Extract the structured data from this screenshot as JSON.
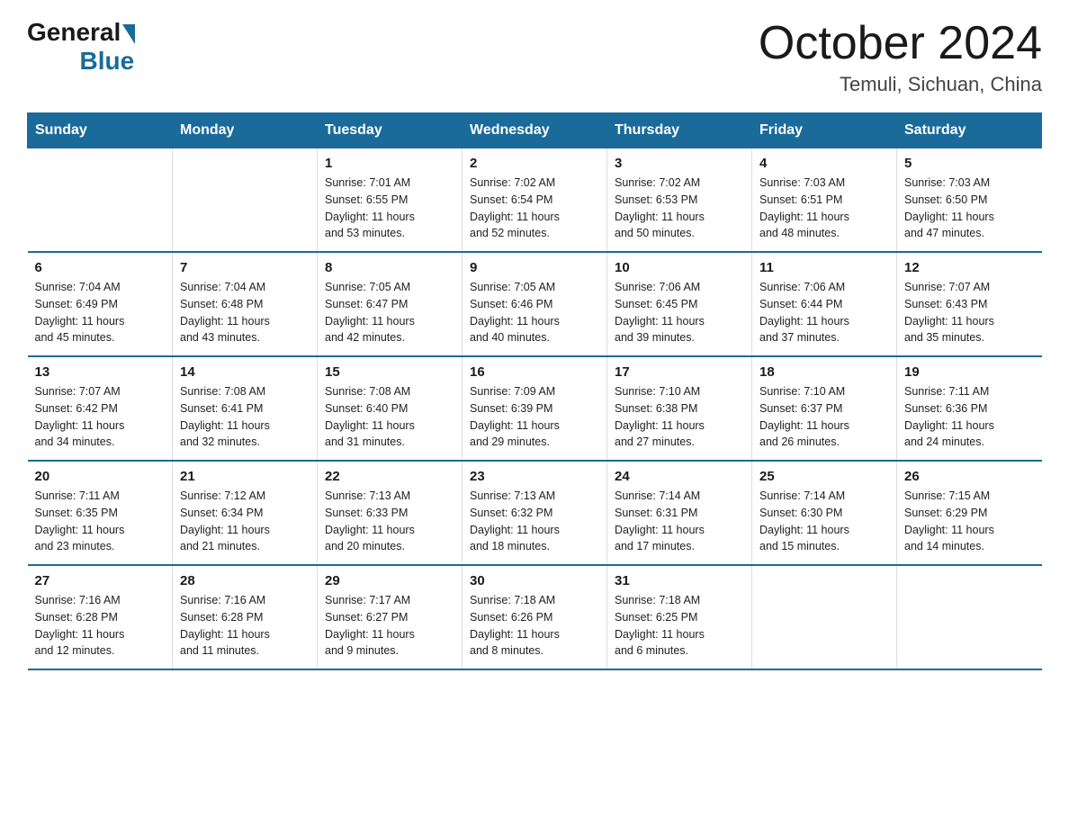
{
  "logo": {
    "general": "General",
    "blue": "Blue"
  },
  "title": "October 2024",
  "location": "Temuli, Sichuan, China",
  "days_of_week": [
    "Sunday",
    "Monday",
    "Tuesday",
    "Wednesday",
    "Thursday",
    "Friday",
    "Saturday"
  ],
  "weeks": [
    [
      {
        "day": "",
        "info": ""
      },
      {
        "day": "",
        "info": ""
      },
      {
        "day": "1",
        "info": "Sunrise: 7:01 AM\nSunset: 6:55 PM\nDaylight: 11 hours\nand 53 minutes."
      },
      {
        "day": "2",
        "info": "Sunrise: 7:02 AM\nSunset: 6:54 PM\nDaylight: 11 hours\nand 52 minutes."
      },
      {
        "day": "3",
        "info": "Sunrise: 7:02 AM\nSunset: 6:53 PM\nDaylight: 11 hours\nand 50 minutes."
      },
      {
        "day": "4",
        "info": "Sunrise: 7:03 AM\nSunset: 6:51 PM\nDaylight: 11 hours\nand 48 minutes."
      },
      {
        "day": "5",
        "info": "Sunrise: 7:03 AM\nSunset: 6:50 PM\nDaylight: 11 hours\nand 47 minutes."
      }
    ],
    [
      {
        "day": "6",
        "info": "Sunrise: 7:04 AM\nSunset: 6:49 PM\nDaylight: 11 hours\nand 45 minutes."
      },
      {
        "day": "7",
        "info": "Sunrise: 7:04 AM\nSunset: 6:48 PM\nDaylight: 11 hours\nand 43 minutes."
      },
      {
        "day": "8",
        "info": "Sunrise: 7:05 AM\nSunset: 6:47 PM\nDaylight: 11 hours\nand 42 minutes."
      },
      {
        "day": "9",
        "info": "Sunrise: 7:05 AM\nSunset: 6:46 PM\nDaylight: 11 hours\nand 40 minutes."
      },
      {
        "day": "10",
        "info": "Sunrise: 7:06 AM\nSunset: 6:45 PM\nDaylight: 11 hours\nand 39 minutes."
      },
      {
        "day": "11",
        "info": "Sunrise: 7:06 AM\nSunset: 6:44 PM\nDaylight: 11 hours\nand 37 minutes."
      },
      {
        "day": "12",
        "info": "Sunrise: 7:07 AM\nSunset: 6:43 PM\nDaylight: 11 hours\nand 35 minutes."
      }
    ],
    [
      {
        "day": "13",
        "info": "Sunrise: 7:07 AM\nSunset: 6:42 PM\nDaylight: 11 hours\nand 34 minutes."
      },
      {
        "day": "14",
        "info": "Sunrise: 7:08 AM\nSunset: 6:41 PM\nDaylight: 11 hours\nand 32 minutes."
      },
      {
        "day": "15",
        "info": "Sunrise: 7:08 AM\nSunset: 6:40 PM\nDaylight: 11 hours\nand 31 minutes."
      },
      {
        "day": "16",
        "info": "Sunrise: 7:09 AM\nSunset: 6:39 PM\nDaylight: 11 hours\nand 29 minutes."
      },
      {
        "day": "17",
        "info": "Sunrise: 7:10 AM\nSunset: 6:38 PM\nDaylight: 11 hours\nand 27 minutes."
      },
      {
        "day": "18",
        "info": "Sunrise: 7:10 AM\nSunset: 6:37 PM\nDaylight: 11 hours\nand 26 minutes."
      },
      {
        "day": "19",
        "info": "Sunrise: 7:11 AM\nSunset: 6:36 PM\nDaylight: 11 hours\nand 24 minutes."
      }
    ],
    [
      {
        "day": "20",
        "info": "Sunrise: 7:11 AM\nSunset: 6:35 PM\nDaylight: 11 hours\nand 23 minutes."
      },
      {
        "day": "21",
        "info": "Sunrise: 7:12 AM\nSunset: 6:34 PM\nDaylight: 11 hours\nand 21 minutes."
      },
      {
        "day": "22",
        "info": "Sunrise: 7:13 AM\nSunset: 6:33 PM\nDaylight: 11 hours\nand 20 minutes."
      },
      {
        "day": "23",
        "info": "Sunrise: 7:13 AM\nSunset: 6:32 PM\nDaylight: 11 hours\nand 18 minutes."
      },
      {
        "day": "24",
        "info": "Sunrise: 7:14 AM\nSunset: 6:31 PM\nDaylight: 11 hours\nand 17 minutes."
      },
      {
        "day": "25",
        "info": "Sunrise: 7:14 AM\nSunset: 6:30 PM\nDaylight: 11 hours\nand 15 minutes."
      },
      {
        "day": "26",
        "info": "Sunrise: 7:15 AM\nSunset: 6:29 PM\nDaylight: 11 hours\nand 14 minutes."
      }
    ],
    [
      {
        "day": "27",
        "info": "Sunrise: 7:16 AM\nSunset: 6:28 PM\nDaylight: 11 hours\nand 12 minutes."
      },
      {
        "day": "28",
        "info": "Sunrise: 7:16 AM\nSunset: 6:28 PM\nDaylight: 11 hours\nand 11 minutes."
      },
      {
        "day": "29",
        "info": "Sunrise: 7:17 AM\nSunset: 6:27 PM\nDaylight: 11 hours\nand 9 minutes."
      },
      {
        "day": "30",
        "info": "Sunrise: 7:18 AM\nSunset: 6:26 PM\nDaylight: 11 hours\nand 8 minutes."
      },
      {
        "day": "31",
        "info": "Sunrise: 7:18 AM\nSunset: 6:25 PM\nDaylight: 11 hours\nand 6 minutes."
      },
      {
        "day": "",
        "info": ""
      },
      {
        "day": "",
        "info": ""
      }
    ]
  ]
}
